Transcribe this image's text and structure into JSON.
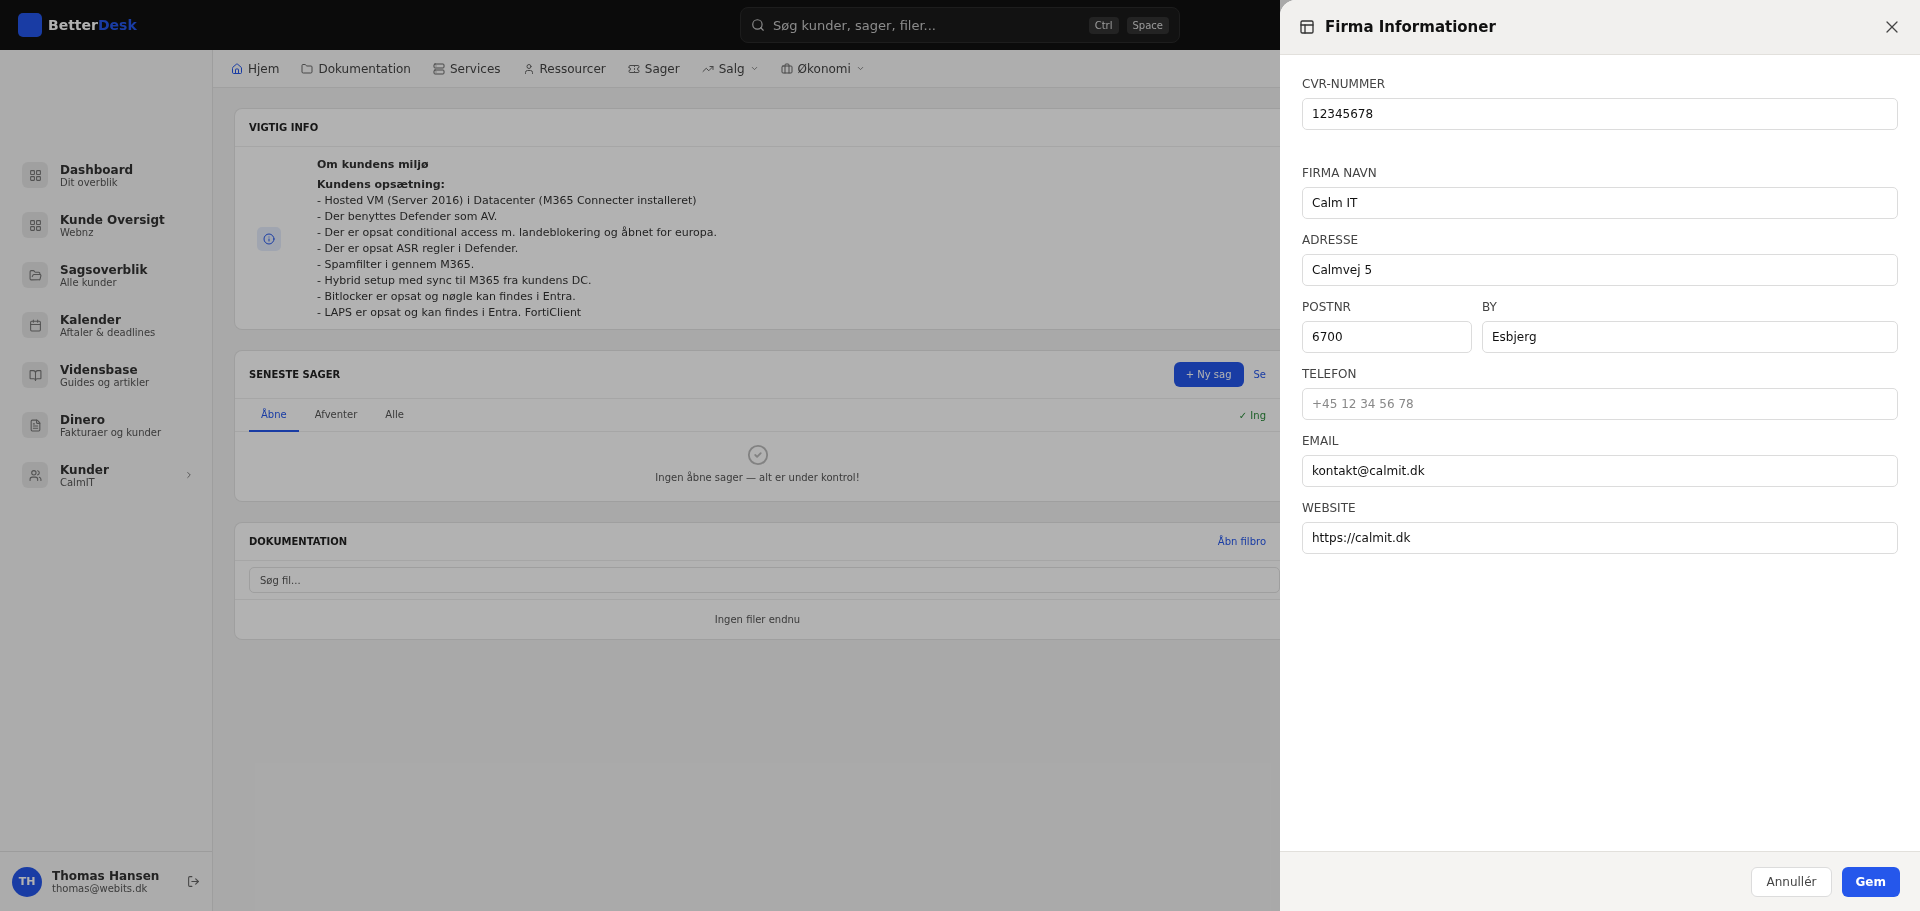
{
  "topbar": {
    "logo": {
      "first": "Better",
      "second": "Desk"
    },
    "search": {
      "placeholder": "Søg kunder, sager, filer...",
      "keys": [
        "Ctrl",
        "Space"
      ]
    }
  },
  "sidebar": {
    "items": [
      {
        "title": "Dashboard",
        "subtitle": "Dit overblik"
      },
      {
        "title": "Kunde Oversigt",
        "subtitle": "Webnz"
      },
      {
        "title": "Sagsoverblik",
        "subtitle": "Alle kunder"
      },
      {
        "title": "Kalender",
        "subtitle": "Aftaler & deadlines"
      },
      {
        "title": "Vidensbase",
        "subtitle": "Guides og artikler"
      },
      {
        "title": "Dinero",
        "subtitle": "Fakturaer og kunder"
      },
      {
        "title": "Kunder",
        "subtitle": "CalmIT",
        "expandable": true
      }
    ],
    "user": {
      "initials": "TH",
      "name": "Thomas Hansen",
      "email": "thomas@webits.dk"
    }
  },
  "nav": [
    {
      "label": "Hjem",
      "selected": true,
      "dropdown": false
    },
    {
      "label": "Dokumentation",
      "selected": false,
      "dropdown": false
    },
    {
      "label": "Services",
      "selected": false,
      "dropdown": false
    },
    {
      "label": "Ressourcer",
      "selected": false,
      "dropdown": false
    },
    {
      "label": "Sager",
      "selected": false,
      "dropdown": false
    },
    {
      "label": "Salg",
      "selected": false,
      "dropdown": true
    },
    {
      "label": "Økonomi",
      "selected": false,
      "dropdown": true
    }
  ],
  "important_info": {
    "title": "VIGTIG INFO",
    "heading": "Om kundens miljø",
    "lines": [
      "**Kundens opsætning:**",
      "- Hosted VM (Server 2016) i Datacenter (M365 Connecter installeret)",
      "- Der benyttes Defender som AV.",
      "- Der er opsat conditional access m. landeblokering og åbnet for europa.",
      "- Der er opsat ASR regler i Defender.",
      "- Spamfilter i gennem M365.",
      "- Hybrid setup med sync til M365 fra kundens DC.",
      "- Bitlocker er opsat og nøgle kan findes i Entra.",
      "- LAPS er opsat og kan findes i Entra. FortiClient"
    ]
  },
  "recent_cases": {
    "title": "SENESTE SAGER",
    "new_button": "+ Ny sag",
    "link": "Se",
    "tabs": [
      {
        "label": "Åbne",
        "selected": true
      },
      {
        "label": "Afventer",
        "selected": false
      },
      {
        "label": "Alle",
        "selected": false
      }
    ],
    "status": "✓ Ing",
    "empty": "Ingen åbne sager — alt er under kontrol!"
  },
  "documentation": {
    "title": "DOKUMENTATION",
    "link": "Åbn filbro",
    "search": {
      "placeholder": "Søg fil..."
    },
    "empty": "Ingen filer endnu"
  },
  "drawer": {
    "title": "Firma Informationer",
    "rows": [
      [
        {
          "label": "CVR-NUMMER",
          "value": "12345678"
        }
      ],
      [
        {
          "label": "FIRMA NAVN",
          "value": "Calm IT"
        }
      ],
      [
        {
          "label": "ADRESSE",
          "value": "Calmvej 5"
        }
      ],
      [
        {
          "label": "POSTNR",
          "value": "6700"
        },
        {
          "label": "BY",
          "value": "Esbjerg"
        }
      ],
      [
        {
          "label": "TELEFON",
          "placeholder": "+45 12 34 56 78"
        }
      ],
      [
        {
          "label": "EMAIL",
          "value": "kontakt@calmit.dk"
        }
      ],
      [
        {
          "label": "WEBSITE",
          "value": "https://calmit.dk"
        }
      ]
    ],
    "buttons": [
      {
        "label": "Annullér",
        "kind": "secondary"
      },
      {
        "label": "Gem",
        "kind": "primary"
      }
    ]
  }
}
